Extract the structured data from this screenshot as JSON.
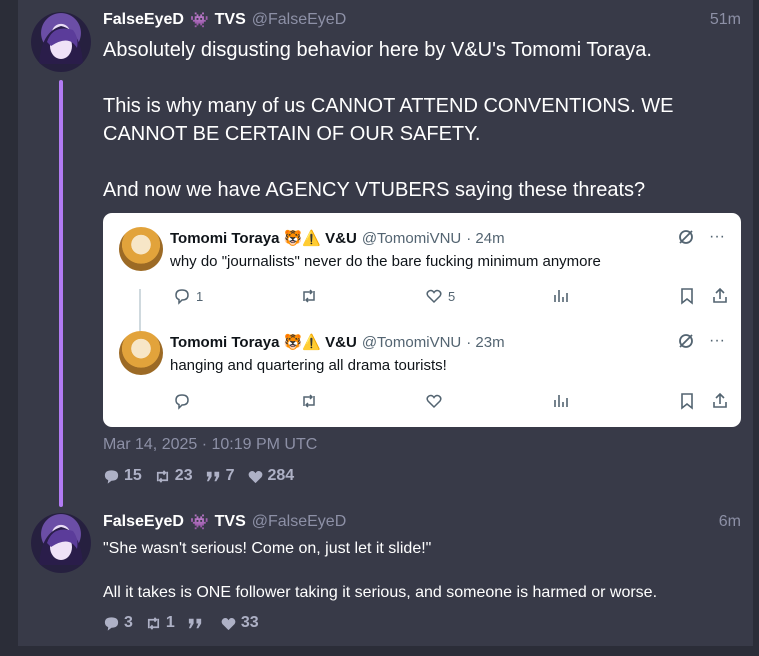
{
  "post1": {
    "name": "FalseEyeD",
    "badge": "👾",
    "tag": "TVS",
    "handle": "@FalseEyeD",
    "time": "51m",
    "text": "Absolutely disgusting behavior here by V&U's Tomomi Toraya.\n\nThis is why many of us CANNOT ATTEND CONVENTIONS. WE CANNOT BE CERTAIN OF OUR SAFETY.\n\nAnd now we have AGENCY VTUBERS saying these threats?",
    "date": "Mar 14, 2025 · 10:19 PM UTC",
    "stats": {
      "replies": "15",
      "reposts": "23",
      "quotes": "7",
      "likes": "284"
    }
  },
  "quote": {
    "items": [
      {
        "name": "Tomomi Toraya 🐯⚠️ V&U",
        "handle": "@TomomiVNU",
        "time": "· 24m",
        "text": "why do \"journalists\" never do the bare fucking minimum anymore",
        "replies": "1",
        "likes": "5"
      },
      {
        "name": "Tomomi Toraya 🐯⚠️ V&U",
        "handle": "@TomomiVNU",
        "time": "· 23m",
        "text": "hanging and quartering all drama tourists!",
        "replies": "",
        "likes": ""
      }
    ],
    "more_icon": "···"
  },
  "post2": {
    "name": "FalseEyeD",
    "badge": "👾",
    "tag": "TVS",
    "handle": "@FalseEyeD",
    "time": "6m",
    "text": "\"She wasn't serious! Come on, just let it slide!\"\n\nAll it takes is ONE follower taking it serious, and someone is harmed or worse.",
    "stats": {
      "replies": "3",
      "reposts": "1",
      "quotes": "",
      "likes": "33"
    }
  },
  "colors": {
    "accent": "#b27bf3",
    "panel": "#383a48",
    "muted": "#8d90a6"
  }
}
